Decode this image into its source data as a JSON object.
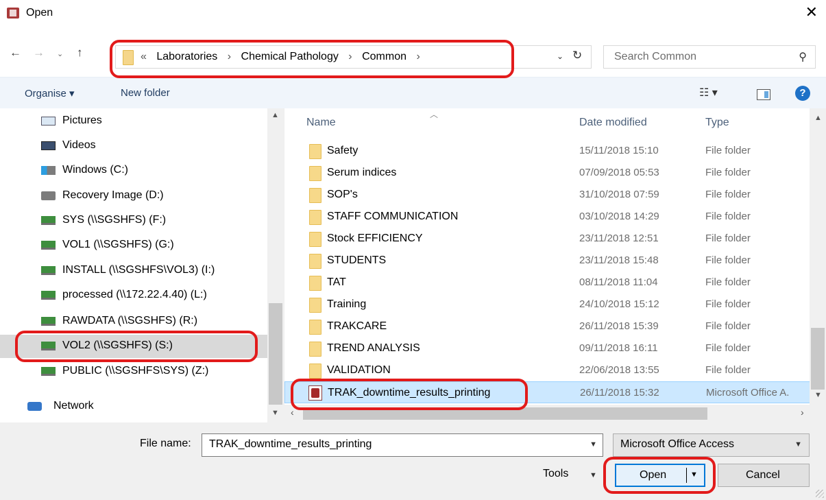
{
  "window": {
    "title": "Open",
    "close_glyph": "✕"
  },
  "nav": {
    "back": "←",
    "forward": "→",
    "recent": "⌄",
    "up": "↑",
    "breadcrumb": [
      "«",
      "Laboratories",
      "›",
      "Chemical Pathology",
      "›",
      "Common",
      "›"
    ],
    "address_dropdown": "⌄",
    "refresh": "↻",
    "search_placeholder": "Search Common",
    "search_icon": "⚲"
  },
  "toolbar": {
    "organise": "Organise ▾",
    "new_folder": "New folder",
    "views": "☷ ▾",
    "help": "?"
  },
  "sidebar": {
    "items": [
      {
        "label": "Pictures",
        "icon": "pictures-icon"
      },
      {
        "label": "Videos",
        "icon": "videos-icon"
      },
      {
        "label": "Windows (C:)",
        "icon": "windows-drive-icon"
      },
      {
        "label": "Recovery Image (D:)",
        "icon": "drive-icon"
      },
      {
        "label": "SYS (\\\\SGSHFS) (F:)",
        "icon": "network-drive-icon"
      },
      {
        "label": "VOL1 (\\\\SGSHFS) (G:)",
        "icon": "network-drive-icon"
      },
      {
        "label": "INSTALL (\\\\SGSHFS\\VOL3) (I:)",
        "icon": "network-drive-icon"
      },
      {
        "label": "processed (\\\\172.22.4.40) (L:)",
        "icon": "network-drive-icon"
      },
      {
        "label": "RAWDATA (\\\\SGSHFS) (R:)",
        "icon": "network-drive-icon"
      },
      {
        "label": "VOL2 (\\\\SGSHFS) (S:)",
        "icon": "network-drive-icon",
        "selected": true
      },
      {
        "label": "PUBLIC (\\\\SGSHFS\\SYS) (Z:)",
        "icon": "network-drive-icon"
      },
      {
        "label": "Network",
        "icon": "network-icon"
      }
    ]
  },
  "files": {
    "columns": {
      "name": "Name",
      "date": "Date modified",
      "type": "Type"
    },
    "rows": [
      {
        "name": "Safety",
        "date": "15/11/2018 15:10",
        "type": "File folder"
      },
      {
        "name": "Serum indices",
        "date": "07/09/2018 05:53",
        "type": "File folder"
      },
      {
        "name": "SOP's",
        "date": "31/10/2018 07:59",
        "type": "File folder"
      },
      {
        "name": "STAFF COMMUNICATION",
        "date": "03/10/2018 14:29",
        "type": "File folder"
      },
      {
        "name": "Stock EFFICIENCY",
        "date": "23/11/2018 12:51",
        "type": "File folder"
      },
      {
        "name": "STUDENTS",
        "date": "23/11/2018 15:48",
        "type": "File folder"
      },
      {
        "name": "TAT",
        "date": "08/11/2018 11:04",
        "type": "File folder"
      },
      {
        "name": "Training",
        "date": "24/10/2018 15:12",
        "type": "File folder"
      },
      {
        "name": "TRAKCARE",
        "date": "26/11/2018 15:39",
        "type": "File folder"
      },
      {
        "name": "TREND ANALYSIS",
        "date": "09/11/2018 16:11",
        "type": "File folder"
      },
      {
        "name": "VALIDATION",
        "date": "22/06/2018 13:55",
        "type": "File folder"
      },
      {
        "name": "TRAK_downtime_results_printing",
        "date": "26/11/2018 15:32",
        "type": "Microsoft Office A.",
        "selected": true
      }
    ]
  },
  "bottom": {
    "file_name_label": "File name:",
    "file_name_value": "TRAK_downtime_results_printing",
    "file_type": "Microsoft Office Access",
    "tools": "Tools",
    "open": "Open",
    "cancel": "Cancel"
  },
  "colors": {
    "annotation": "#e21b1b",
    "selection": "#cce8ff",
    "accent": "#0078d7"
  }
}
